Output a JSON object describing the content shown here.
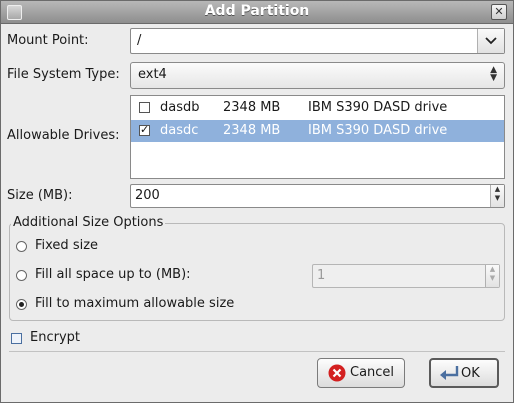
{
  "window": {
    "title": "Add Partition",
    "close_glyph": "✕"
  },
  "mount_point": {
    "label": "Mount Point:",
    "value": "/"
  },
  "fs_type": {
    "label": "File System Type:",
    "value": "ext4"
  },
  "drives": {
    "label": "Allowable Drives:",
    "rows": [
      {
        "name": "dasdb",
        "size": "2348 MB",
        "model": "IBM S390 DASD drive",
        "checked": false,
        "selected": false
      },
      {
        "name": "dasdc",
        "size": "2348 MB",
        "model": "IBM S390 DASD drive",
        "checked": true,
        "selected": true
      }
    ]
  },
  "size": {
    "label": "Size (MB):",
    "value": "200"
  },
  "additional": {
    "title": "Additional Size Options",
    "fixed_label": "Fixed size",
    "fill_upto_label": "Fill all space up to (MB):",
    "fill_upto_value": "1",
    "fill_max_label": "Fill to maximum allowable size",
    "selected": "fill_max"
  },
  "encrypt": {
    "label": "Encrypt",
    "checked": false
  },
  "buttons": {
    "cancel": "Cancel",
    "ok": "OK"
  },
  "colors": {
    "selection": "#8fb1dc",
    "cancel_icon": "#d32020",
    "titlebar": "#a0a0a0"
  }
}
